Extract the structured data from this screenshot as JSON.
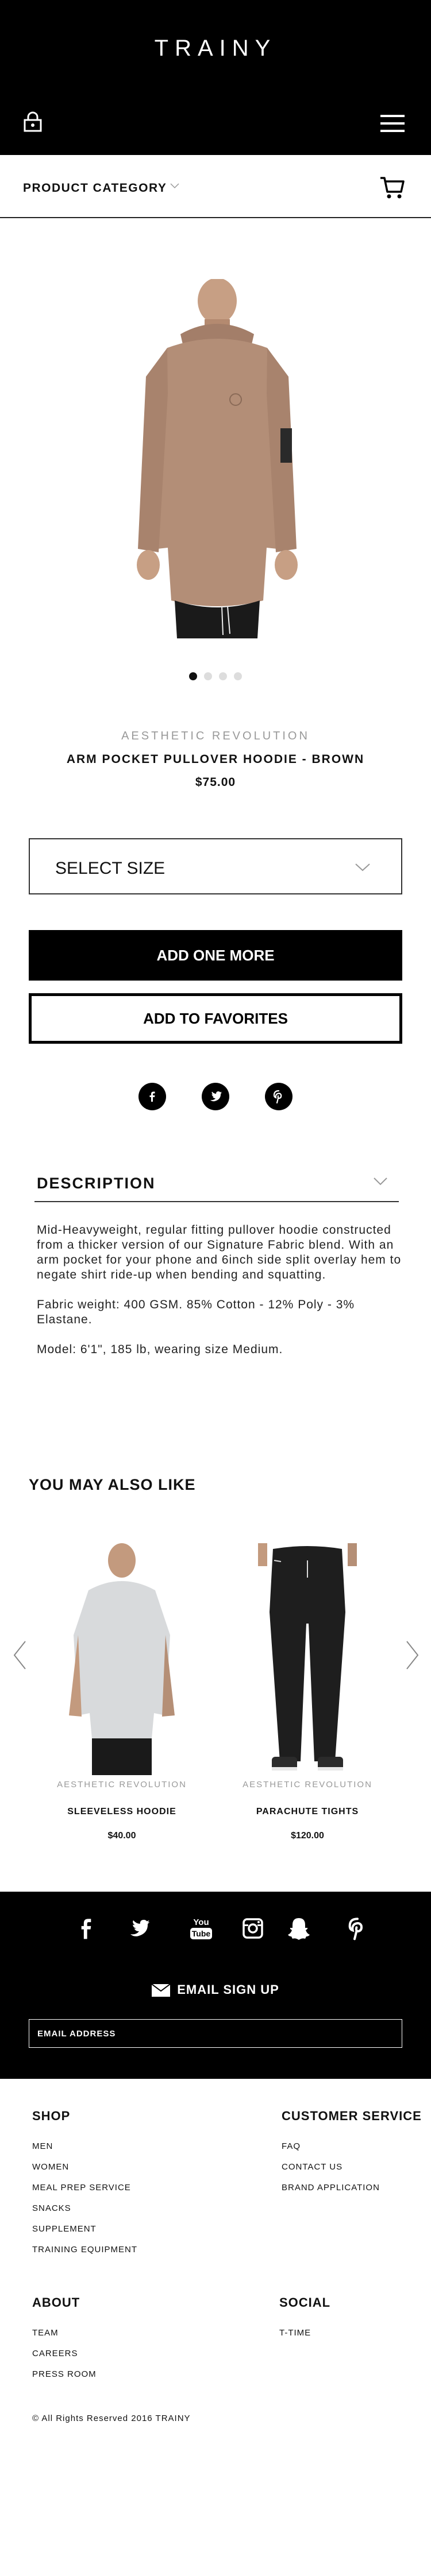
{
  "header": {
    "brand": "TRAINY",
    "icons": {
      "account": "lock-icon",
      "menu": "hamburger-menu-icon"
    }
  },
  "category_bar": {
    "label": "PRODUCT CATEGORY",
    "icons": {
      "chevron": "chevron-down-icon",
      "cart": "cart-icon"
    }
  },
  "product": {
    "carousel": {
      "slide_count": 4,
      "active_index": 0
    },
    "brand": "AESTHETIC REVOLUTION",
    "name": "ARM POCKET PULLOVER HOODIE - BROWN",
    "price": "$75.00",
    "size_select": {
      "selected": "SELECT SIZE"
    },
    "add_button": "ADD ONE MORE",
    "favorites_button": "ADD TO FAVORITES",
    "share_icons": [
      "facebook-icon",
      "twitter-icon",
      "pinterest-icon"
    ]
  },
  "description": {
    "title": "DESCRIPTION",
    "paragraphs": [
      "Mid-Heavyweight, regular fitting pullover hoodie constructed from a thicker version of our Signature Fabric blend. With an arm pocket for your phone and 6inch side split overlay hem to negate shirt ride-up when bending and squatting.",
      "Fabric weight: 400 GSM. 85% Cotton - 12% Poly - 3% Elastane.",
      "Model: 6'1\", 185 lb, wearing size Medium."
    ]
  },
  "recommendations": {
    "title": "YOU MAY ALSO LIKE",
    "items": [
      {
        "brand": "AESTHETIC REVOLUTION",
        "name": "SLEEVELESS HOODIE",
        "price": "$40.00"
      },
      {
        "brand": "AESTHETIC REVOLUTION",
        "name": "PARACHUTE  TIGHTS",
        "price": "$120.00"
      }
    ]
  },
  "footer": {
    "social_icons": [
      "facebook-icon",
      "twitter-icon",
      "youtube-icon",
      "instagram-icon",
      "snapchat-icon",
      "pinterest-icon"
    ],
    "youtube_text": "You",
    "youtube_tube": "Tube",
    "signup_label": "EMAIL SIGN UP",
    "email_placeholder": "EMAIL ADDRESS",
    "shop": {
      "title": "SHOP",
      "links": [
        "MEN",
        "WOMEN",
        "MEAL PREP SERVICE",
        "SNACKS",
        "SUPPLEMENT",
        "TRAINING EQUIPMENT"
      ]
    },
    "customer_service": {
      "title": "CUSTOMER SERVICE",
      "links": [
        "FAQ",
        "CONTACT US",
        "BRAND APPLICATION"
      ]
    },
    "about": {
      "title": "ABOUT",
      "links": [
        "TEAM",
        "CAREERS",
        "PRESS ROOM"
      ]
    },
    "social": {
      "title": "SOCIAL",
      "links": [
        "T-TIME"
      ]
    },
    "copyright": "© All Rights Reserved 2016 TRAINY"
  },
  "colors": {
    "primary": "#000000",
    "background": "#ffffff",
    "muted": "#999999",
    "hoodie": "#b38e77"
  }
}
